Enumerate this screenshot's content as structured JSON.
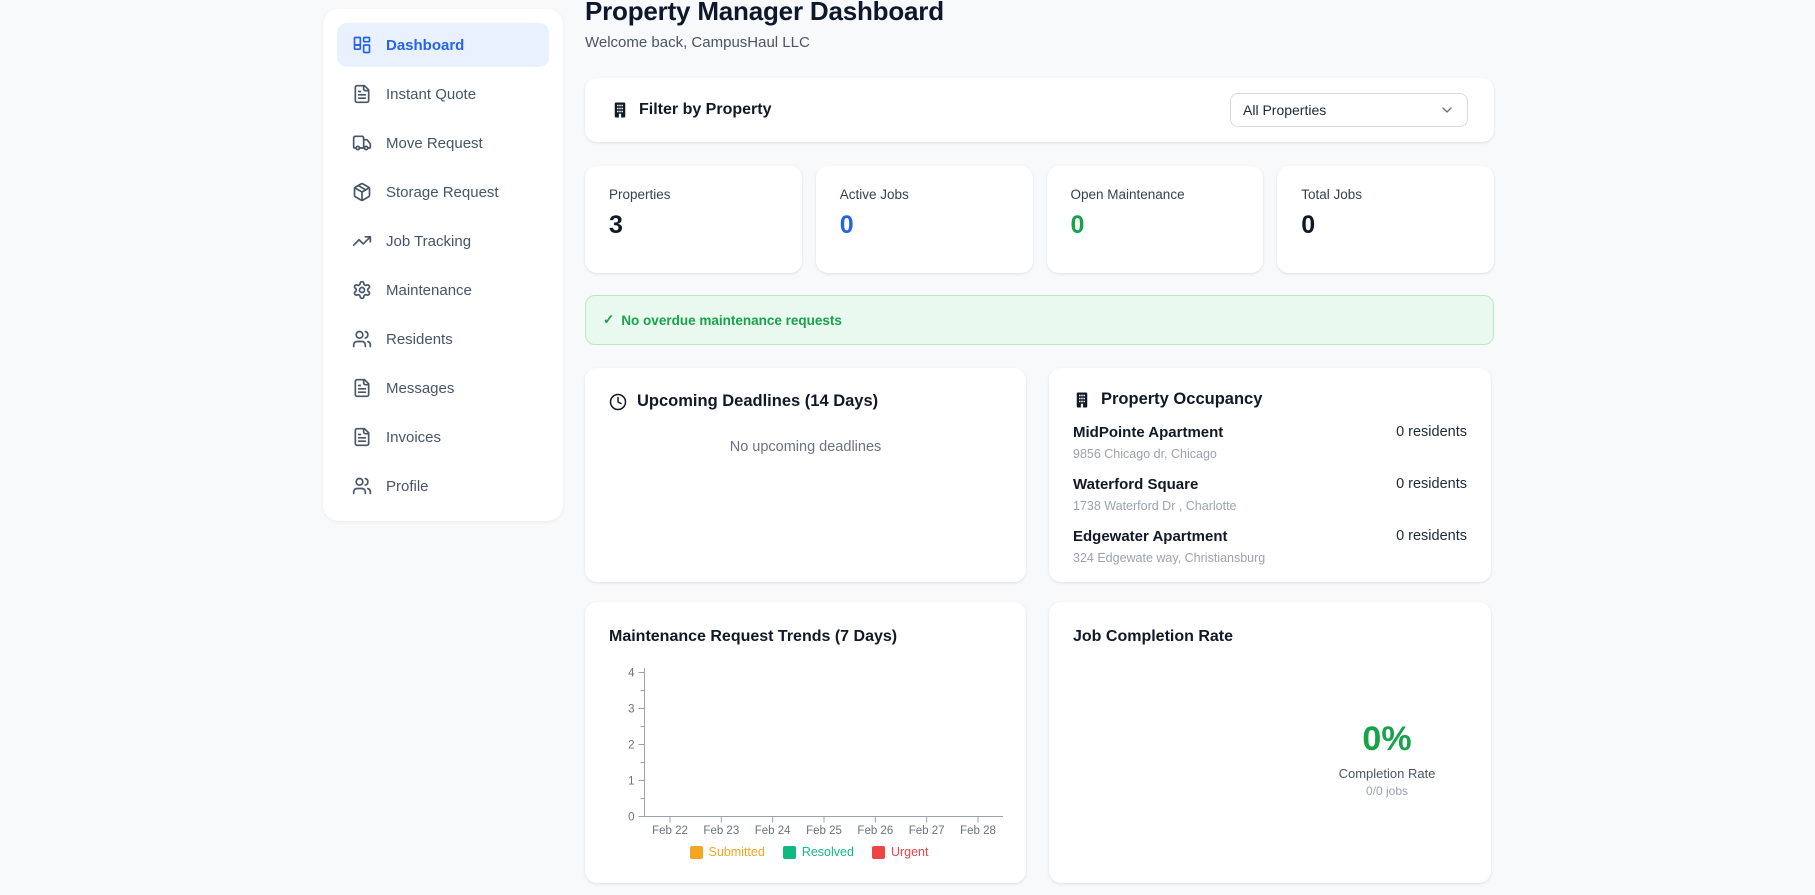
{
  "page": {
    "title": "Property Manager Dashboard",
    "subtitle": "Welcome back, CampusHaul LLC"
  },
  "sidebar": {
    "items": [
      {
        "label": "Dashboard",
        "icon": "dashboard-icon",
        "active": true
      },
      {
        "label": "Instant Quote",
        "icon": "file-icon",
        "active": false
      },
      {
        "label": "Move Request",
        "icon": "truck-icon",
        "active": false
      },
      {
        "label": "Storage Request",
        "icon": "package-icon",
        "active": false
      },
      {
        "label": "Job Tracking",
        "icon": "trending-up-icon",
        "active": false
      },
      {
        "label": "Maintenance",
        "icon": "gear-icon",
        "active": false
      },
      {
        "label": "Residents",
        "icon": "users-icon",
        "active": false
      },
      {
        "label": "Messages",
        "icon": "file-icon",
        "active": false
      },
      {
        "label": "Invoices",
        "icon": "file-icon",
        "active": false
      },
      {
        "label": "Profile",
        "icon": "users-icon",
        "active": false
      }
    ]
  },
  "filter": {
    "label": "Filter by Property",
    "selected": "All Properties"
  },
  "stats": [
    {
      "label": "Properties",
      "value": "3",
      "color": "#111827"
    },
    {
      "label": "Active Jobs",
      "value": "0",
      "color": "#2563eb"
    },
    {
      "label": "Open Maintenance",
      "value": "0",
      "color": "#16a34a"
    },
    {
      "label": "Total Jobs",
      "value": "0",
      "color": "#111827"
    }
  ],
  "banner": {
    "check": "✓",
    "text": "No overdue maintenance requests",
    "text_color": "#16a34a",
    "bg_color": "#e9f9ef",
    "border_color": "#b9e7c9"
  },
  "deadlines": {
    "title": "Upcoming Deadlines (14 Days)",
    "empty_text": "No upcoming deadlines"
  },
  "occupancy": {
    "title": "Property Occupancy",
    "rows": [
      {
        "name": "MidPointe Apartment",
        "address": "9856 Chicago dr, Chicago",
        "residents": "0 residents"
      },
      {
        "name": "Waterford Square",
        "address": "1738 Waterford Dr , Charlotte",
        "residents": "0 residents"
      },
      {
        "name": "Edgewater Apartment",
        "address": "324 Edgewate way, Christiansburg",
        "residents": "0 residents"
      }
    ]
  },
  "trends": {
    "title": "Maintenance Request Trends (7 Days)",
    "chart_data": {
      "type": "line",
      "categories": [
        "Feb 22",
        "Feb 23",
        "Feb 24",
        "Feb 25",
        "Feb 26",
        "Feb 27",
        "Feb 28"
      ],
      "series": [
        {
          "name": "Submitted",
          "color": "#f5a524",
          "values": []
        },
        {
          "name": "Resolved",
          "color": "#10b981",
          "values": []
        },
        {
          "name": "Urgent",
          "color": "#ef4444",
          "values": []
        }
      ],
      "ylim": [
        0,
        4
      ],
      "yticks": [
        0,
        1,
        2,
        3,
        4
      ],
      "minor_tick_step": 0.5,
      "grid": false,
      "legend_position": "bottom",
      "axis_color": "#9ca3af",
      "note": "no data plotted - empty chart"
    }
  },
  "completion": {
    "title": "Job Completion Rate",
    "rate": "0%",
    "rate_color": "#16a34a",
    "label": "Completion Rate",
    "jobs": "0/0 jobs"
  }
}
